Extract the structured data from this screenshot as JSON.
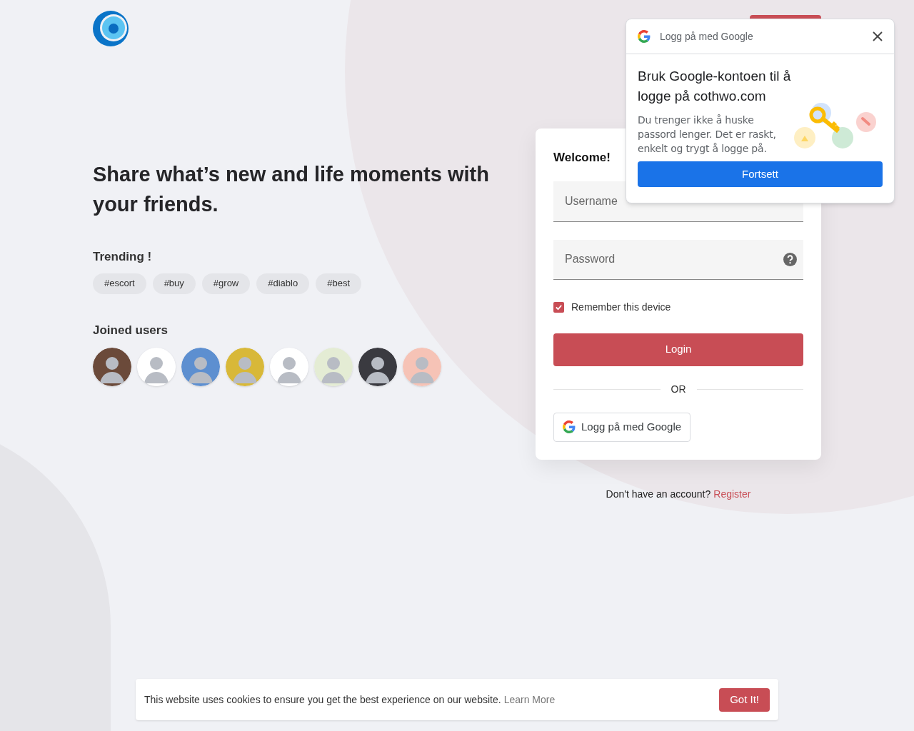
{
  "hero": {
    "headline": "Share what’s new and life moments with your friends.",
    "trending_title": "Trending !",
    "tags": [
      "#escort",
      "#buy",
      "#grow",
      "#diablo",
      "#best"
    ],
    "joined_title": "Joined users",
    "joined_users": [
      {
        "kind": "photo"
      },
      {
        "kind": "photo"
      },
      {
        "kind": "photo"
      },
      {
        "kind": "photo"
      },
      {
        "kind": "photo"
      },
      {
        "kind": "photo"
      },
      {
        "kind": "photo"
      },
      {
        "kind": "photo"
      }
    ]
  },
  "login_card": {
    "title": "Welcome!",
    "username": {
      "placeholder": "Username"
    },
    "password": {
      "placeholder": "Password"
    },
    "remember": {
      "label": "Remember this device",
      "checked": true
    },
    "login_button": "Login",
    "divider": "OR",
    "google_button": "Logg på med Google"
  },
  "register_prompt": {
    "text": "Don't have an account?",
    "link": "Register"
  },
  "google_popup": {
    "header": "Logg på med Google",
    "title": "Bruk Google-kontoen til å logge på cothwo.com",
    "body": "Du trenger ikke å huske passord lenger. Det er raskt, enkelt og trygt å logge på.",
    "button": "Fortsett"
  },
  "cookie_banner": {
    "text": "This website uses cookies to ensure you get the best experience on our website.",
    "link": "Learn More",
    "button": "Got It!"
  }
}
